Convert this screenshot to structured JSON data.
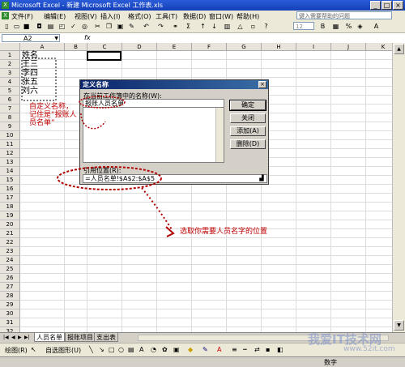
{
  "window": {
    "title": "Microsoft Excel - 新建 Microsoft Excel 工作表.xls"
  },
  "menu": {
    "items": [
      "文件(F)",
      "编辑(E)",
      "视图(V)",
      "插入(I)",
      "格式(O)",
      "工具(T)",
      "数据(D)",
      "窗口(W)",
      "帮助(H)"
    ],
    "help_placeholder": "键入需要帮助的问题"
  },
  "toolbar": {
    "font_size": "12"
  },
  "formula_bar": {
    "name_box": "A2",
    "fx": "fx",
    "formula": ""
  },
  "grid": {
    "columns": [
      "A",
      "B",
      "C",
      "D",
      "E",
      "F",
      "G",
      "H",
      "I",
      "J",
      "K"
    ],
    "rows": [
      "1",
      "2",
      "3",
      "4",
      "5",
      "6",
      "7",
      "8",
      "9",
      "10",
      "11",
      "12",
      "13",
      "14",
      "15",
      "16",
      "17",
      "18",
      "19",
      "20",
      "21",
      "22",
      "23",
      "24",
      "25",
      "26",
      "27",
      "28",
      "29",
      "30",
      "31",
      "32"
    ],
    "column_a": [
      "姓名",
      "王三",
      "李四",
      "张五",
      "刘六"
    ]
  },
  "dialog": {
    "title": "定义名称",
    "names_label": "在当前工作簿中的名称(W):",
    "name_value": "报账人员名单",
    "refers_label": "引用位置(R):",
    "refers_value": "=人员名单!$A$2:$A$5",
    "buttons": [
      "确定",
      "关闭",
      "添加(A)",
      "删除(D)"
    ]
  },
  "sheet_tabs": [
    "人员名单",
    "报账项目",
    "支出表"
  ],
  "drawbar": {
    "draw_label": "绘图(R)",
    "autoshape_label": "自选图形(U)"
  },
  "status": {
    "mode": "数字"
  },
  "annotations": {
    "note1": "自定义名称，记住是“报账人员名单”",
    "note2": "选取你需要人员名字的位置"
  },
  "watermark": {
    "line1": "我爱IT技术网",
    "line2": "www.52it.com"
  },
  "colors": {
    "annotation_red": "#c00000",
    "title_blue": "#0a246a"
  }
}
